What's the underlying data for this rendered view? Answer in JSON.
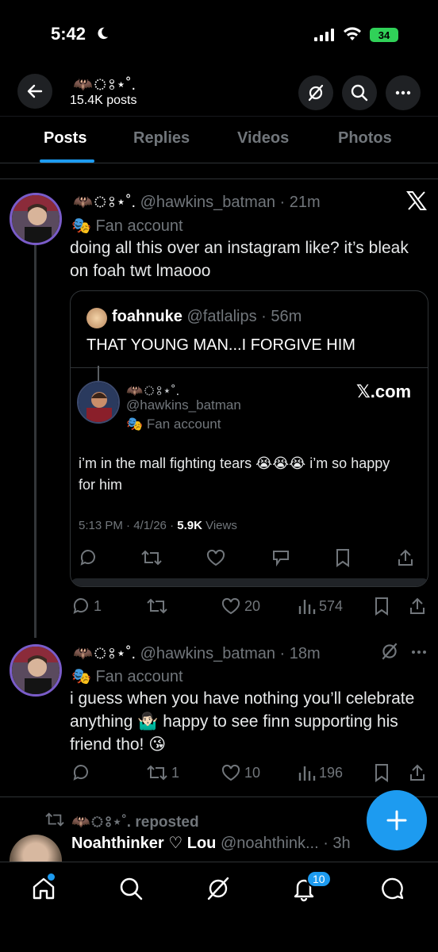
{
  "status_bar": {
    "time": "5:42",
    "battery": "34"
  },
  "header": {
    "name": "🦇ঃ⋆˚.",
    "posts_count": "15.4K posts"
  },
  "tabs": [
    {
      "label": "Posts"
    },
    {
      "label": "Replies"
    },
    {
      "label": "Videos"
    },
    {
      "label": "Photos"
    }
  ],
  "post1": {
    "display_name": "🦇ঃ⋆˚.",
    "handle": "@hawkins_batman",
    "time": "· 21m",
    "label": "Fan account",
    "text": "doing all this over an instagram like? it’s bleak on foah twt lmaooo",
    "quote": {
      "display_name": "foahnuke",
      "handle": "@fatlalips",
      "time": "· 56m",
      "text": "THAT YOUNG MAN...I FORGIVE HIM",
      "embed": {
        "display_name": "🦇ঃ⋆˚.",
        "handle": "@hawkins_batman",
        "label": "Fan account",
        "brand": "𝕏.com",
        "text": "i’m in the mall fighting tears 😭😭😭 i’m so happy for him",
        "meta": "5:13 PM · 4/1/26 · ",
        "views_count": "5.9K",
        "views_label": " Views"
      }
    },
    "actions": {
      "replies": "1",
      "retweets": "",
      "likes": "20",
      "views": "574"
    }
  },
  "post2": {
    "display_name": "🦇ঃ⋆˚.",
    "handle": "@hawkins_batman",
    "time": "· 18m",
    "label": "Fan account",
    "text": "i guess when you have nothing you’ll celebrate anything 🤷🏻‍♂️ happy to see finn supporting his friend tho! 😘",
    "actions": {
      "replies": "",
      "retweets": "1",
      "likes": "10",
      "views": "196"
    }
  },
  "post3": {
    "repost_label": "🦇ঃ⋆˚. reposted",
    "display_name": "Noahthinker ♡ Lou",
    "handle": "@noahthink...",
    "time": "· 3h"
  },
  "bottom_nav": {
    "notifications_badge": "10"
  },
  "colors": {
    "accent": "#1d9bf0",
    "muted": "#71767b",
    "battery": "#30d158"
  }
}
